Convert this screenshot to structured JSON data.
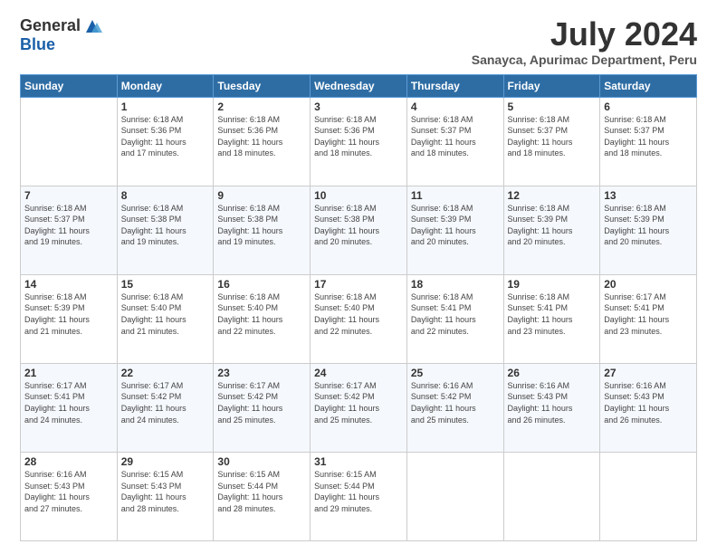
{
  "logo": {
    "general": "General",
    "blue": "Blue"
  },
  "header": {
    "month": "July 2024",
    "location": "Sanayca, Apurimac Department, Peru"
  },
  "days": [
    "Sunday",
    "Monday",
    "Tuesday",
    "Wednesday",
    "Thursday",
    "Friday",
    "Saturday"
  ],
  "weeks": [
    [
      {
        "day": "",
        "info": ""
      },
      {
        "day": "1",
        "info": "Sunrise: 6:18 AM\nSunset: 5:36 PM\nDaylight: 11 hours\nand 17 minutes."
      },
      {
        "day": "2",
        "info": "Sunrise: 6:18 AM\nSunset: 5:36 PM\nDaylight: 11 hours\nand 18 minutes."
      },
      {
        "day": "3",
        "info": "Sunrise: 6:18 AM\nSunset: 5:36 PM\nDaylight: 11 hours\nand 18 minutes."
      },
      {
        "day": "4",
        "info": "Sunrise: 6:18 AM\nSunset: 5:37 PM\nDaylight: 11 hours\nand 18 minutes."
      },
      {
        "day": "5",
        "info": "Sunrise: 6:18 AM\nSunset: 5:37 PM\nDaylight: 11 hours\nand 18 minutes."
      },
      {
        "day": "6",
        "info": "Sunrise: 6:18 AM\nSunset: 5:37 PM\nDaylight: 11 hours\nand 18 minutes."
      }
    ],
    [
      {
        "day": "7",
        "info": "Sunrise: 6:18 AM\nSunset: 5:37 PM\nDaylight: 11 hours\nand 19 minutes."
      },
      {
        "day": "8",
        "info": "Sunrise: 6:18 AM\nSunset: 5:38 PM\nDaylight: 11 hours\nand 19 minutes."
      },
      {
        "day": "9",
        "info": "Sunrise: 6:18 AM\nSunset: 5:38 PM\nDaylight: 11 hours\nand 19 minutes."
      },
      {
        "day": "10",
        "info": "Sunrise: 6:18 AM\nSunset: 5:38 PM\nDaylight: 11 hours\nand 20 minutes."
      },
      {
        "day": "11",
        "info": "Sunrise: 6:18 AM\nSunset: 5:39 PM\nDaylight: 11 hours\nand 20 minutes."
      },
      {
        "day": "12",
        "info": "Sunrise: 6:18 AM\nSunset: 5:39 PM\nDaylight: 11 hours\nand 20 minutes."
      },
      {
        "day": "13",
        "info": "Sunrise: 6:18 AM\nSunset: 5:39 PM\nDaylight: 11 hours\nand 20 minutes."
      }
    ],
    [
      {
        "day": "14",
        "info": "Sunrise: 6:18 AM\nSunset: 5:39 PM\nDaylight: 11 hours\nand 21 minutes."
      },
      {
        "day": "15",
        "info": "Sunrise: 6:18 AM\nSunset: 5:40 PM\nDaylight: 11 hours\nand 21 minutes."
      },
      {
        "day": "16",
        "info": "Sunrise: 6:18 AM\nSunset: 5:40 PM\nDaylight: 11 hours\nand 22 minutes."
      },
      {
        "day": "17",
        "info": "Sunrise: 6:18 AM\nSunset: 5:40 PM\nDaylight: 11 hours\nand 22 minutes."
      },
      {
        "day": "18",
        "info": "Sunrise: 6:18 AM\nSunset: 5:41 PM\nDaylight: 11 hours\nand 22 minutes."
      },
      {
        "day": "19",
        "info": "Sunrise: 6:18 AM\nSunset: 5:41 PM\nDaylight: 11 hours\nand 23 minutes."
      },
      {
        "day": "20",
        "info": "Sunrise: 6:17 AM\nSunset: 5:41 PM\nDaylight: 11 hours\nand 23 minutes."
      }
    ],
    [
      {
        "day": "21",
        "info": "Sunrise: 6:17 AM\nSunset: 5:41 PM\nDaylight: 11 hours\nand 24 minutes."
      },
      {
        "day": "22",
        "info": "Sunrise: 6:17 AM\nSunset: 5:42 PM\nDaylight: 11 hours\nand 24 minutes."
      },
      {
        "day": "23",
        "info": "Sunrise: 6:17 AM\nSunset: 5:42 PM\nDaylight: 11 hours\nand 25 minutes."
      },
      {
        "day": "24",
        "info": "Sunrise: 6:17 AM\nSunset: 5:42 PM\nDaylight: 11 hours\nand 25 minutes."
      },
      {
        "day": "25",
        "info": "Sunrise: 6:16 AM\nSunset: 5:42 PM\nDaylight: 11 hours\nand 25 minutes."
      },
      {
        "day": "26",
        "info": "Sunrise: 6:16 AM\nSunset: 5:43 PM\nDaylight: 11 hours\nand 26 minutes."
      },
      {
        "day": "27",
        "info": "Sunrise: 6:16 AM\nSunset: 5:43 PM\nDaylight: 11 hours\nand 26 minutes."
      }
    ],
    [
      {
        "day": "28",
        "info": "Sunrise: 6:16 AM\nSunset: 5:43 PM\nDaylight: 11 hours\nand 27 minutes."
      },
      {
        "day": "29",
        "info": "Sunrise: 6:15 AM\nSunset: 5:43 PM\nDaylight: 11 hours\nand 28 minutes."
      },
      {
        "day": "30",
        "info": "Sunrise: 6:15 AM\nSunset: 5:44 PM\nDaylight: 11 hours\nand 28 minutes."
      },
      {
        "day": "31",
        "info": "Sunrise: 6:15 AM\nSunset: 5:44 PM\nDaylight: 11 hours\nand 29 minutes."
      },
      {
        "day": "",
        "info": ""
      },
      {
        "day": "",
        "info": ""
      },
      {
        "day": "",
        "info": ""
      }
    ]
  ]
}
